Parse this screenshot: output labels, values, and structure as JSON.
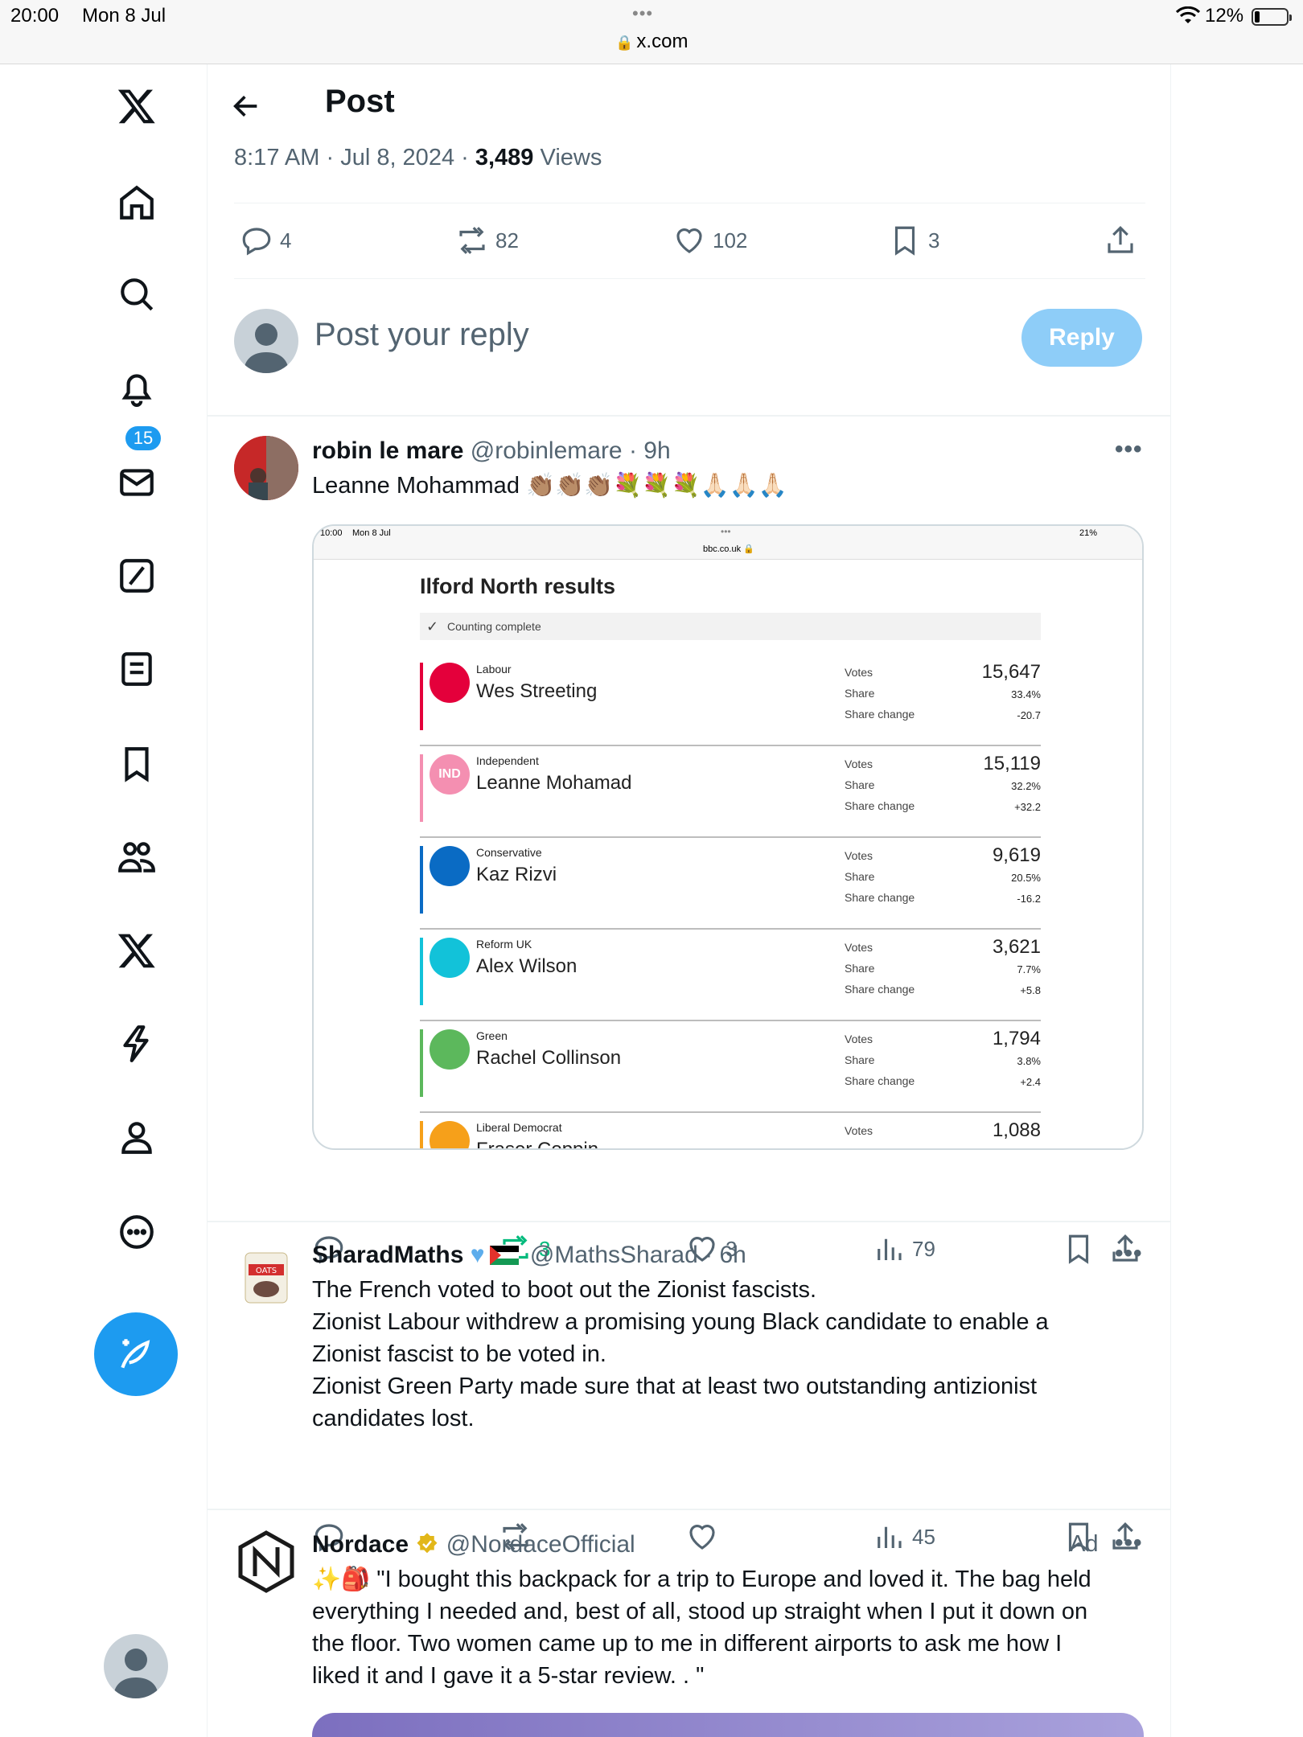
{
  "status_bar": {
    "time": "20:00",
    "date": "Mon 8 Jul",
    "dots": "•••",
    "url": "x.com",
    "battery": "12%"
  },
  "sidebar": {
    "notification_count": "15",
    "items": [
      "x-logo",
      "home",
      "explore",
      "notifications",
      "messages",
      "grok",
      "lists",
      "bookmarks",
      "communities",
      "premium",
      "verified-orgs",
      "profile",
      "more"
    ]
  },
  "header": {
    "title": "Post"
  },
  "post_meta": {
    "time": "8:17 AM",
    "date": "Jul 8, 2024",
    "views_count": "3,489",
    "views_label": "Views"
  },
  "post_actions": {
    "replies": "4",
    "reposts": "82",
    "likes": "102",
    "bookmarks": "3"
  },
  "reply_box": {
    "placeholder": "Post your reply",
    "button": "Reply"
  },
  "replies": [
    {
      "name": "robin le mare",
      "handle": "@robinlemare",
      "time": "· 9h",
      "text": "Leanne Mohammad 👏🏽👏🏽👏🏽💐💐💐🙏🏻🙏🏻🙏🏻",
      "actions": {
        "reposts": "3",
        "likes": "3",
        "views": "79"
      },
      "embedded": {
        "time": "10:00",
        "date": "Mon 8 Jul",
        "url": "bbc.co.uk 🔒",
        "battery": "21%",
        "title": "Ilford North results",
        "status": "Counting complete",
        "labels": {
          "votes": "Votes",
          "share": "Share",
          "change": "Share change"
        },
        "candidates": [
          {
            "party": "Labour",
            "name": "Wes Streeting",
            "votes": "15,647",
            "share": "33.4%",
            "change": "-20.7",
            "color": "#e4003b",
            "logo": ""
          },
          {
            "party": "Independent",
            "name": "Leanne Mohamad",
            "votes": "15,119",
            "share": "32.2%",
            "change": "+32.2",
            "color": "#f48fb1",
            "logo": "IND"
          },
          {
            "party": "Conservative",
            "name": "Kaz Rizvi",
            "votes": "9,619",
            "share": "20.5%",
            "change": "-16.2",
            "color": "#0a6bc4",
            "logo": ""
          },
          {
            "party": "Reform UK",
            "name": "Alex Wilson",
            "votes": "3,621",
            "share": "7.7%",
            "change": "+5.8",
            "color": "#12c2d9",
            "logo": ""
          },
          {
            "party": "Green",
            "name": "Rachel Collinson",
            "votes": "1,794",
            "share": "3.8%",
            "change": "+2.4",
            "color": "#5cb85c",
            "logo": ""
          },
          {
            "party": "Liberal Democrat",
            "name": "Fraser Coppin",
            "votes": "1,088",
            "share": "",
            "change": "",
            "color": "#f6a01a",
            "logo": ""
          }
        ]
      }
    },
    {
      "name": "SharadMaths",
      "handle": "@MathsSharad",
      "time": "· 6h",
      "lines": [
        "The French voted to boot out the Zionist fascists.",
        "Zionist Labour withdrew a promising young Black candidate to enable a",
        "Zionist fascist to be voted in.",
        "Zionist Green Party made sure that at least two outstanding antizionist",
        "candidates lost."
      ],
      "actions": {
        "views": "45"
      }
    },
    {
      "name": "Nordace",
      "handle": "@NordaceOfficial",
      "ad_label": "Ad",
      "lines": [
        "✨🎒 \"I bought this backpack for a trip to Europe and loved it. The bag held",
        "everything I needed and, best of all, stood up straight when I put it down on",
        "the floor. Two women came up to me in different airports to ask me how I",
        "liked it and I gave it a 5-star review. . \""
      ]
    }
  ],
  "colors": {
    "accent": "#1d9bf0",
    "repost_green": "#00ba7c",
    "muted": "#536471"
  }
}
